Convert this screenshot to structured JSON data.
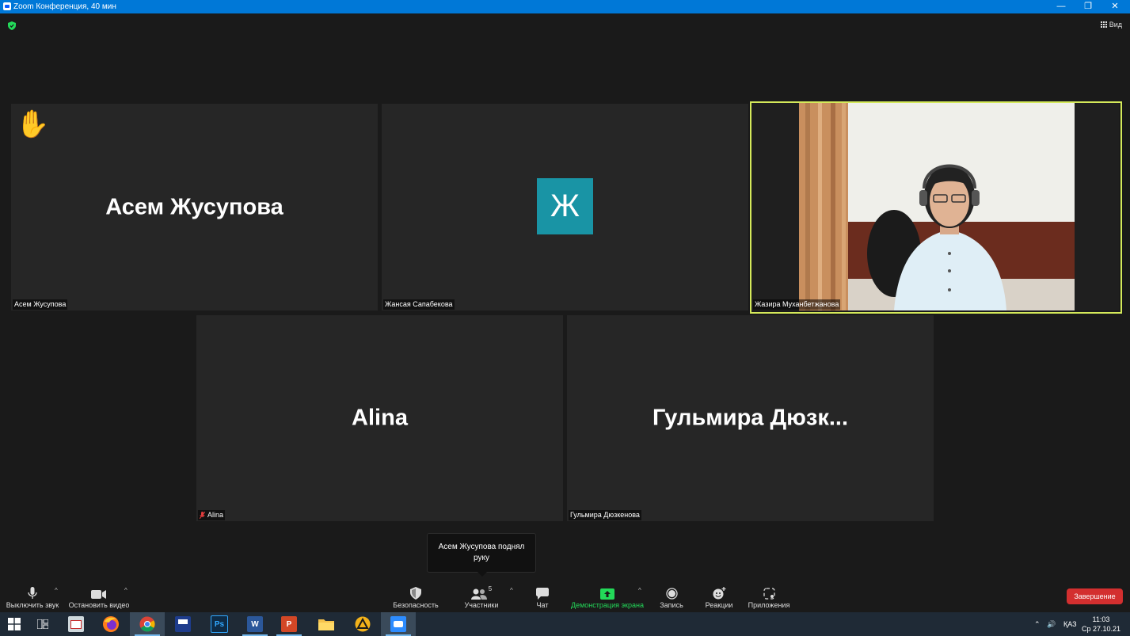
{
  "window": {
    "title": "Zoom Конференция, 40 мин",
    "controls": [
      "—",
      "❐",
      "✕"
    ]
  },
  "topbar": {
    "view_label": "Вид"
  },
  "tiles": [
    {
      "display_name": "Асем Жусупова",
      "label": "Асем Жусупова",
      "hand_raised": true
    },
    {
      "avatar_letter": "Ж",
      "avatar_color": "#1994a5",
      "label": "Жансая Сапабекова"
    },
    {
      "label": "Жазира Муханбетжанова",
      "active_speaker": true,
      "active_color": "#d4e95a"
    },
    {
      "display_name": "Alina",
      "label": "Alina",
      "muted": true
    },
    {
      "display_name": "Гульмира  Дюзк...",
      "label": "Гульмира Дюзкенова"
    }
  ],
  "tooltip": {
    "text": "Асем Жусупова поднял руку"
  },
  "toolbar": {
    "mute_label": "Выключить звук",
    "video_label": "Остановить видео",
    "security_label": "Безопасность",
    "participants_label": "Участники",
    "participants_count": "5",
    "chat_label": "Чат",
    "share_label": "Демонстрация экрана",
    "record_label": "Запись",
    "reactions_label": "Реакции",
    "apps_label": "Приложения",
    "end_label": "Завершение",
    "share_color": "#23d959",
    "end_color": "#d32f2f"
  },
  "taskbar": {
    "apps": [
      "start-icon",
      "task-view-icon",
      "screenshot-app-icon",
      "firefox-icon",
      "chrome-icon",
      "save-app-icon",
      "photoshop-icon",
      "word-icon",
      "powerpoint-icon",
      "file-explorer-icon",
      "autocad-icon",
      "zoom-icon"
    ],
    "ps_text": "Ps",
    "word_text": "W",
    "ppt_text": "P",
    "lang": "ҚАЗ",
    "time": "11:03",
    "date": "Ср 27.10.21"
  }
}
